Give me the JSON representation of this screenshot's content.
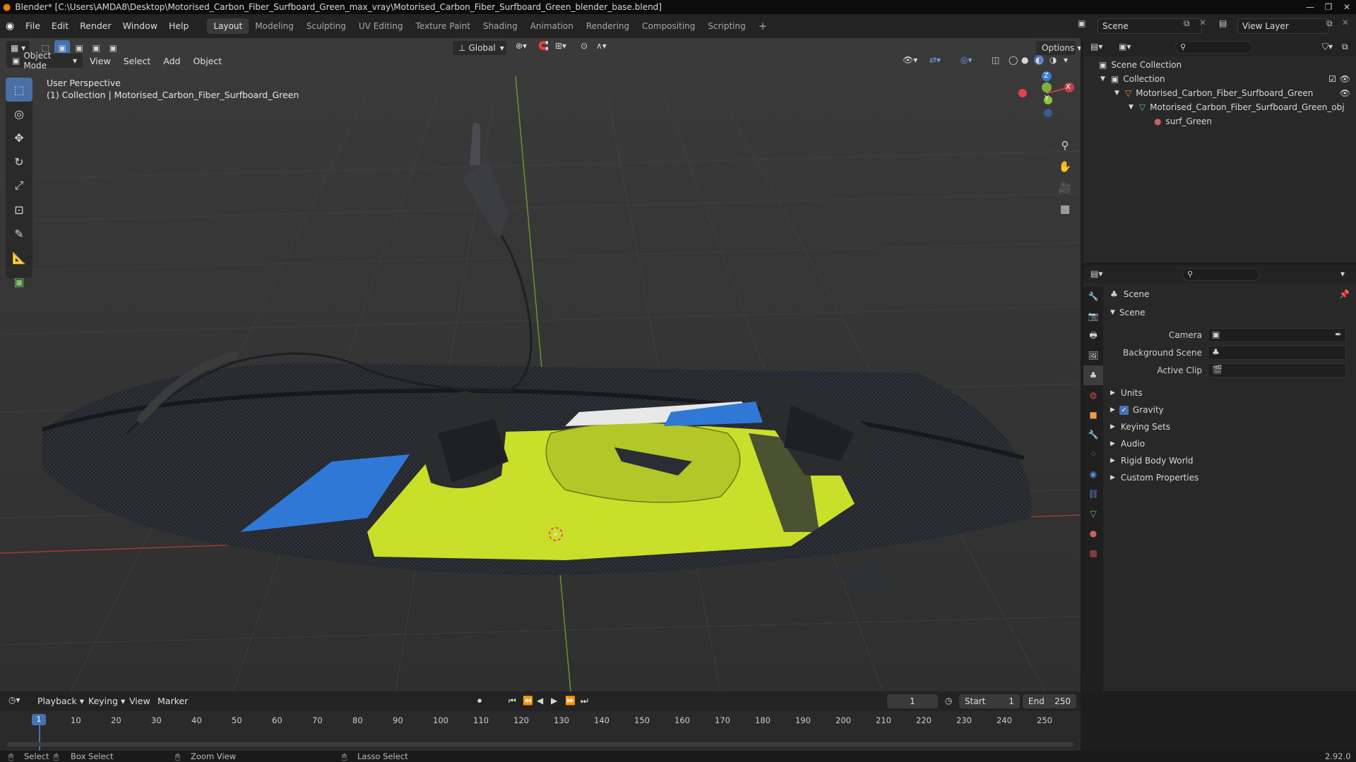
{
  "titlebar": {
    "title": "Blender* [C:\\Users\\AMDA8\\Desktop\\Motorised_Carbon_Fiber_Surfboard_Green_max_vray\\Motorised_Carbon_Fiber_Surfboard_Green_blender_base.blend]",
    "minimize": "—",
    "maximize": "❐",
    "close": "✕"
  },
  "menu": [
    "File",
    "Edit",
    "Render",
    "Window",
    "Help"
  ],
  "workspaces": [
    "Layout",
    "Modeling",
    "Sculpting",
    "UV Editing",
    "Texture Paint",
    "Shading",
    "Animation",
    "Rendering",
    "Compositing",
    "Scripting"
  ],
  "workspace_add": "+",
  "scene_name": "Scene",
  "view_layer": "View Layer",
  "viewport": {
    "mode": "Object Mode",
    "menus": [
      "View",
      "Select",
      "Add",
      "Object"
    ],
    "transform_orientation": "Global",
    "options": "Options",
    "perspective": "User Perspective",
    "collection_info": "(1) Collection | Motorised_Carbon_Fiber_Surfboard_Green",
    "gizmo": {
      "x": "X",
      "y": "Y",
      "z": "Z"
    }
  },
  "outliner": {
    "root": "Scene Collection",
    "items": [
      {
        "label": "Collection"
      },
      {
        "label": "Motorised_Carbon_Fiber_Surfboard_Green"
      },
      {
        "label": "Motorised_Carbon_Fiber_Surfboard_Green_obj"
      },
      {
        "label": "surf_Green"
      }
    ]
  },
  "properties": {
    "header": "Scene",
    "panel": "Scene",
    "fields": [
      {
        "label": "Camera"
      },
      {
        "label": "Background Scene"
      },
      {
        "label": "Active Clip"
      }
    ],
    "sections": [
      "Units",
      "Gravity",
      "Keying Sets",
      "Audio",
      "Rigid Body World",
      "Custom Properties"
    ],
    "gravity_enabled": true
  },
  "timeline": {
    "menus": [
      "Playback",
      "Keying",
      "View",
      "Marker"
    ],
    "current_frame": "1",
    "start_label": "Start",
    "start": "1",
    "end_label": "End",
    "end": "250",
    "ticks": [
      "10",
      "20",
      "30",
      "40",
      "50",
      "60",
      "70",
      "80",
      "90",
      "100",
      "110",
      "120",
      "130",
      "140",
      "150",
      "160",
      "170",
      "180",
      "190",
      "200",
      "210",
      "220",
      "230",
      "240",
      "250"
    ],
    "cursor": "1"
  },
  "statusbar": {
    "select": "Select",
    "box_select": "Box Select",
    "zoom_view": "Zoom View",
    "lasso_select": "Lasso Select",
    "version": "2.92.0"
  },
  "colors": {
    "accent": "#4772b3",
    "board_yellow": "#c9df2a",
    "board_blue": "#2f78d6",
    "axis_red": "#b83a3a",
    "axis_green": "#7fa238"
  }
}
